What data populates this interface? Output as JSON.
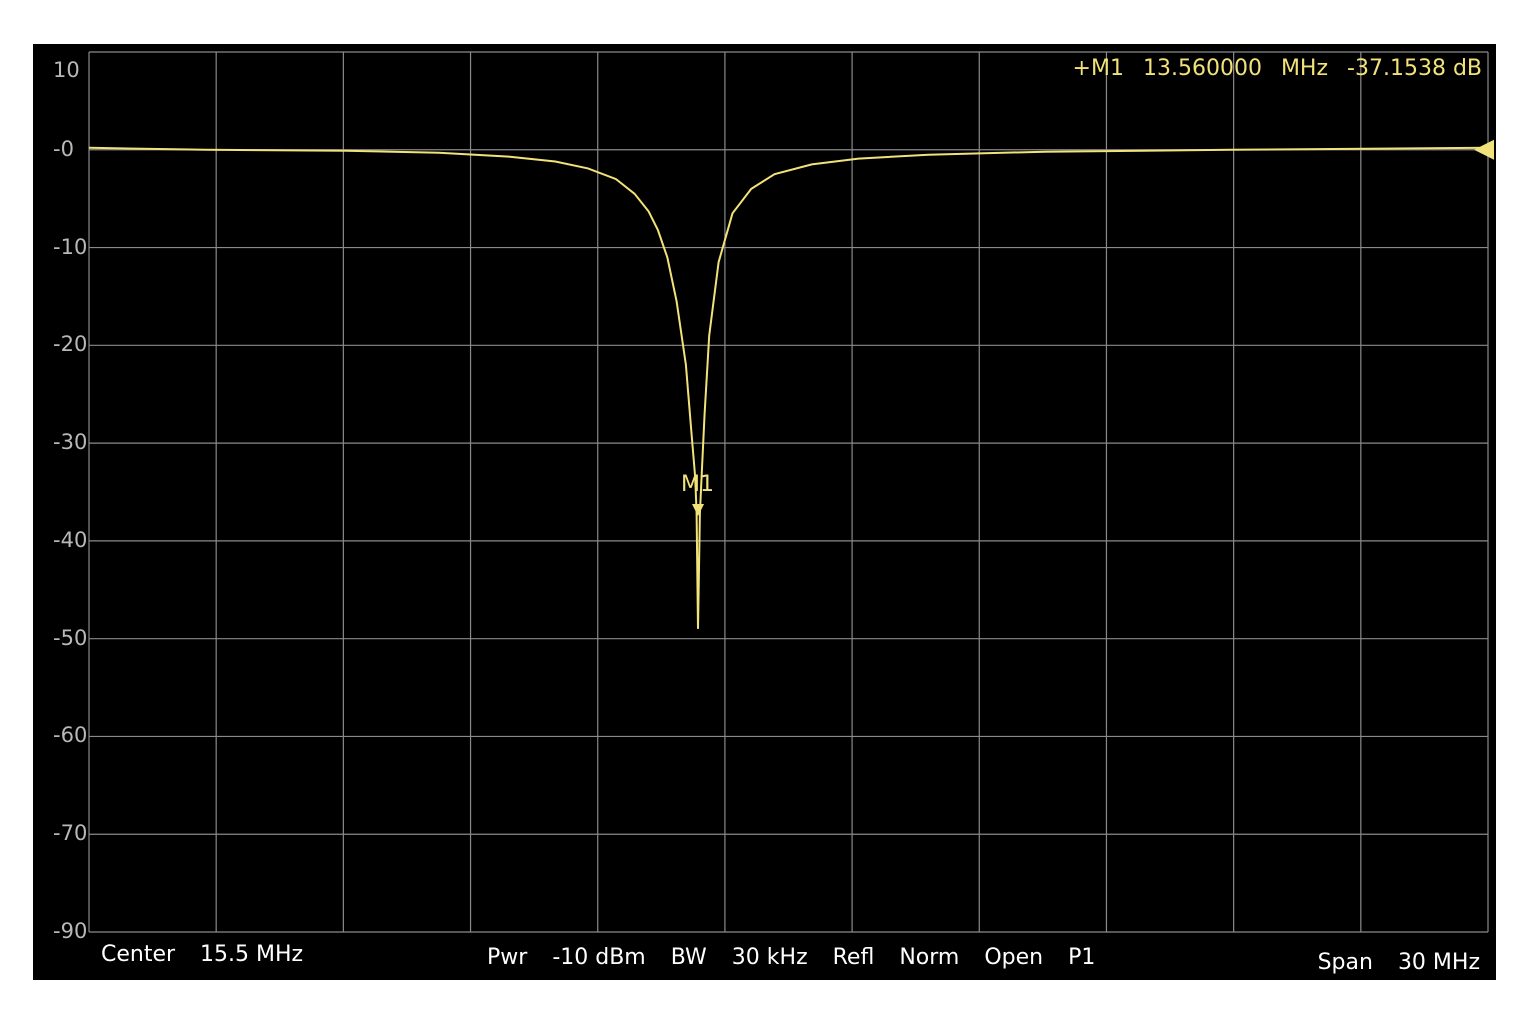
{
  "colors": {
    "background": "#000000",
    "grid": "#8a8a8a",
    "trace": "#f2e27a",
    "text": "#ffffff",
    "axis_text": "#b8b8b8"
  },
  "marker_readout": {
    "name": "+M1",
    "frequency": "13.560000",
    "freq_unit": "MHz",
    "level": "-37.1538 dB"
  },
  "marker": {
    "label": "M1",
    "x_mhz": 13.56,
    "y_db": -37.1538
  },
  "footer": {
    "center_label": "Center",
    "center_value": "15.5 MHz",
    "pwr_label": "Pwr",
    "pwr_value": "-10 dBm",
    "bw_label": "BW",
    "bw_value": "30 kHz",
    "refl_label": "Refl",
    "norm_label": "Norm",
    "open_label": "Open",
    "port_label": "P1",
    "span_label": "Span",
    "span_value": "30 MHz"
  },
  "chart_data": {
    "type": "line",
    "xlim": [
      0.5,
      30.5
    ],
    "ylim": [
      -90,
      10
    ],
    "y_tick_labels": [
      "10",
      "-0",
      "-10",
      "-20",
      "-30",
      "-40",
      "-50",
      "-60",
      "-70",
      "-90"
    ],
    "reference_level_db": 0,
    "grid": true,
    "series": [
      {
        "x": [
          0.5,
          3,
          6,
          8,
          9.5,
          10.5,
          11.2,
          11.8,
          12.2,
          12.5,
          12.7,
          12.9,
          13.1,
          13.3,
          13.42,
          13.5,
          13.53,
          13.56,
          13.6,
          13.64,
          13.7,
          13.8,
          14.0,
          14.3,
          14.7,
          15.2,
          16,
          17,
          18.5,
          21,
          25,
          30.5
        ],
        "y": [
          0.2,
          0.0,
          -0.1,
          -0.3,
          -0.7,
          -1.2,
          -1.9,
          -3.0,
          -4.5,
          -6.3,
          -8.2,
          -11.0,
          -15.5,
          -22.0,
          -29.0,
          -33.5,
          -37.2,
          -49.0,
          -37.2,
          -33.0,
          -27.0,
          -19.0,
          -11.5,
          -6.5,
          -4.0,
          -2.5,
          -1.5,
          -0.9,
          -0.5,
          -0.2,
          0.0,
          0.2
        ]
      }
    ]
  }
}
